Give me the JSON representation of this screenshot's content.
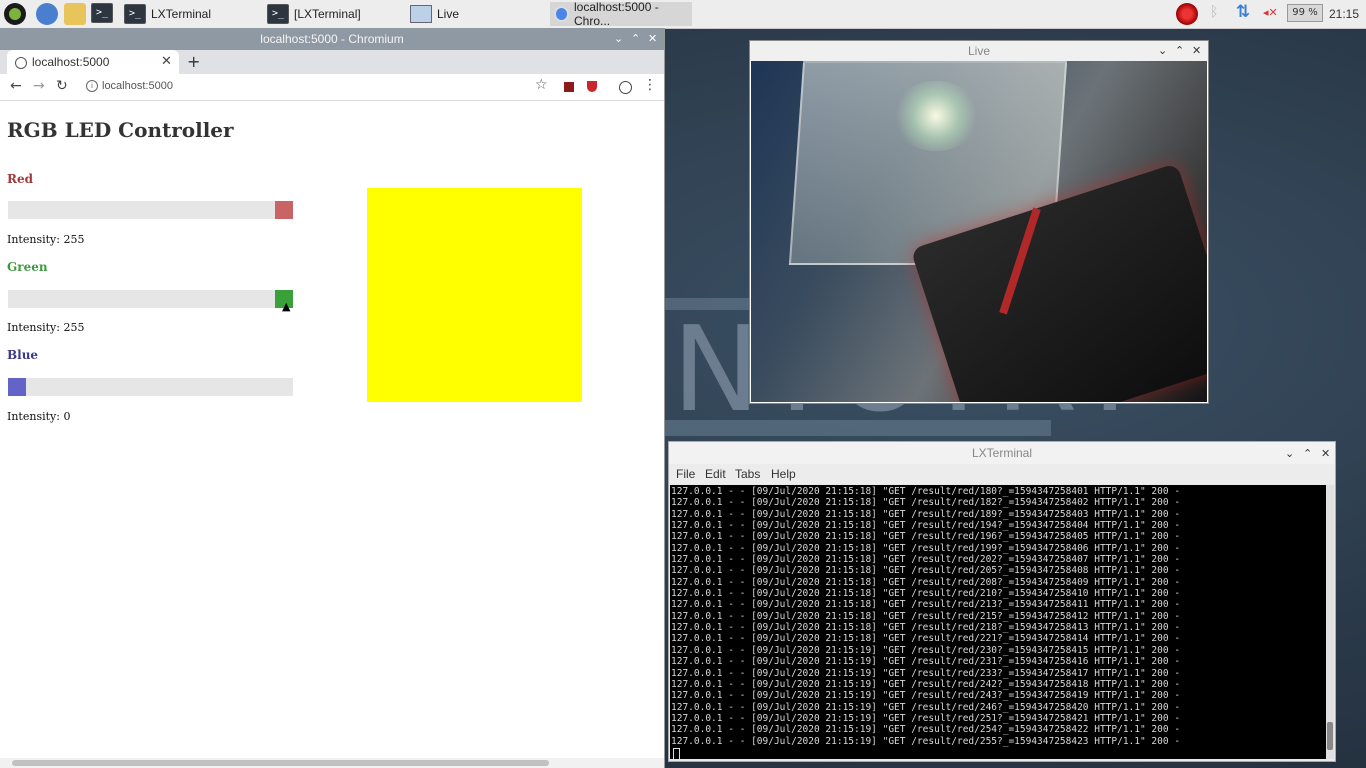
{
  "taskbar": {
    "items": [
      {
        "label": "LXTerminal"
      },
      {
        "label": "[LXTerminal]"
      },
      {
        "label": "Live"
      },
      {
        "label": "localhost:5000 - Chro..."
      }
    ],
    "battery": "99 %",
    "clock": "21:15"
  },
  "chromium": {
    "window_title": "localhost:5000 - Chromium",
    "tab_title": "localhost:5000",
    "url": "localhost:5000",
    "page": {
      "title": "RGB LED Controller",
      "channels": [
        {
          "label": "Red",
          "intensity_text": "Intensity: 255",
          "value": 255,
          "max": 255,
          "color": "#a03a3a",
          "thumb_color": "#c86464"
        },
        {
          "label": "Green",
          "intensity_text": "Intensity: 255",
          "value": 255,
          "max": 255,
          "color": "#3f9a3f",
          "thumb_color": "#3aa03a"
        },
        {
          "label": "Blue",
          "intensity_text": "Intensity: 0",
          "value": 0,
          "max": 255,
          "color": "#3a3a8a",
          "thumb_color": "#6464c8"
        }
      ],
      "preview_color": "#ffff00"
    }
  },
  "live": {
    "window_title": "Live"
  },
  "terminal": {
    "window_title": "LXTerminal",
    "menu": [
      "File",
      "Edit",
      "Tabs",
      "Help"
    ],
    "lines": [
      "127.0.0.1 - - [09/Jul/2020 21:15:18] \"GET /result/red/180?_=1594347258401 HTTP/1.1\" 200 -",
      "127.0.0.1 - - [09/Jul/2020 21:15:18] \"GET /result/red/182?_=1594347258402 HTTP/1.1\" 200 -",
      "127.0.0.1 - - [09/Jul/2020 21:15:18] \"GET /result/red/189?_=1594347258403 HTTP/1.1\" 200 -",
      "127.0.0.1 - - [09/Jul/2020 21:15:18] \"GET /result/red/194?_=1594347258404 HTTP/1.1\" 200 -",
      "127.0.0.1 - - [09/Jul/2020 21:15:18] \"GET /result/red/196?_=1594347258405 HTTP/1.1\" 200 -",
      "127.0.0.1 - - [09/Jul/2020 21:15:18] \"GET /result/red/199?_=1594347258406 HTTP/1.1\" 200 -",
      "127.0.0.1 - - [09/Jul/2020 21:15:18] \"GET /result/red/202?_=1594347258407 HTTP/1.1\" 200 -",
      "127.0.0.1 - - [09/Jul/2020 21:15:18] \"GET /result/red/205?_=1594347258408 HTTP/1.1\" 200 -",
      "127.0.0.1 - - [09/Jul/2020 21:15:18] \"GET /result/red/208?_=1594347258409 HTTP/1.1\" 200 -",
      "127.0.0.1 - - [09/Jul/2020 21:15:18] \"GET /result/red/210?_=1594347258410 HTTP/1.1\" 200 -",
      "127.0.0.1 - - [09/Jul/2020 21:15:18] \"GET /result/red/213?_=1594347258411 HTTP/1.1\" 200 -",
      "127.0.0.1 - - [09/Jul/2020 21:15:18] \"GET /result/red/215?_=1594347258412 HTTP/1.1\" 200 -",
      "127.0.0.1 - - [09/Jul/2020 21:15:18] \"GET /result/red/218?_=1594347258413 HTTP/1.1\" 200 -",
      "127.0.0.1 - - [09/Jul/2020 21:15:18] \"GET /result/red/221?_=1594347258414 HTTP/1.1\" 200 -",
      "127.0.0.1 - - [09/Jul/2020 21:15:19] \"GET /result/red/230?_=1594347258415 HTTP/1.1\" 200 -",
      "127.0.0.1 - - [09/Jul/2020 21:15:19] \"GET /result/red/231?_=1594347258416 HTTP/1.1\" 200 -",
      "127.0.0.1 - - [09/Jul/2020 21:15:19] \"GET /result/red/233?_=1594347258417 HTTP/1.1\" 200 -",
      "127.0.0.1 - - [09/Jul/2020 21:15:19] \"GET /result/red/242?_=1594347258418 HTTP/1.1\" 200 -",
      "127.0.0.1 - - [09/Jul/2020 21:15:19] \"GET /result/red/243?_=1594347258419 HTTP/1.1\" 200 -",
      "127.0.0.1 - - [09/Jul/2020 21:15:19] \"GET /result/red/246?_=1594347258420 HTTP/1.1\" 200 -",
      "127.0.0.1 - - [09/Jul/2020 21:15:19] \"GET /result/red/251?_=1594347258421 HTTP/1.1\" 200 -",
      "127.0.0.1 - - [09/Jul/2020 21:15:19] \"GET /result/red/254?_=1594347258422 HTTP/1.1\" 200 -",
      "127.0.0.1 - - [09/Jul/2020 21:15:19] \"GET /result/red/255?_=1594347258423 HTTP/1.1\" 200 -"
    ]
  }
}
